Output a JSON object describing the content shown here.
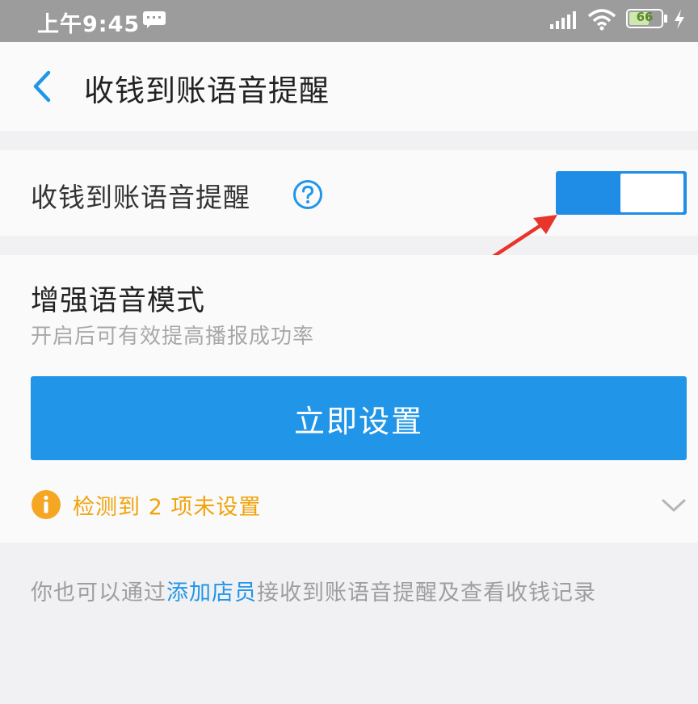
{
  "status_bar": {
    "time": "上午9:45",
    "battery": "66",
    "icons": [
      "message-icon",
      "signal-icon",
      "wifi-icon",
      "battery-icon",
      "charging-icon"
    ]
  },
  "header": {
    "back_icon": "chevron-left-icon",
    "title": "收钱到账语音提醒"
  },
  "voice_alert": {
    "label": "收钱到账语音提醒",
    "help_icon": "question-circle-icon",
    "enabled": true
  },
  "enhanced_mode": {
    "title": "增强语音模式",
    "description": "开启后可有效提高播报成功率",
    "button_label": "立即设置",
    "warning_text": "检测到 2 项未设置",
    "warning_icon": "info-circle-icon"
  },
  "footer": {
    "prefix": "你也可以通过",
    "link": "添加店员",
    "suffix": "接收到账语音提醒及查看收钱记录"
  },
  "colors": {
    "accent": "#2196e8",
    "toggle_on": "#1f8ce6",
    "warning": "#f0a30a",
    "annotation_arrow": "#e8352b"
  }
}
